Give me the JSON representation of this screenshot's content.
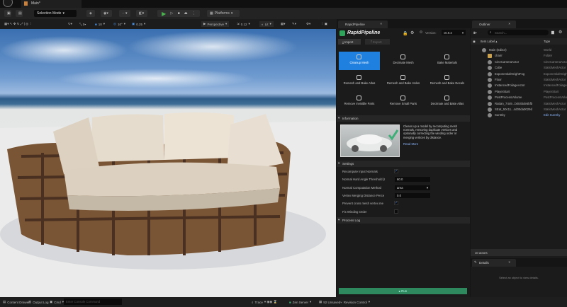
{
  "title_bar": {
    "tab": "Main*"
  },
  "toolbar": {
    "selection_mode": "Selection Mode",
    "platforms": "Platforms"
  },
  "viewport_toolbar": {
    "snap_translate": "10",
    "snap_rotate": "10°",
    "snap_scale": "0.25",
    "view_mode": "Perspective",
    "camera_speed": "0.12",
    "lighting": "Lit",
    "grid": "0"
  },
  "rapid_pipeline": {
    "tab": "RapidPipeline",
    "brand": "RapidPipeline",
    "version_label": "Version:",
    "version": "v0.9.3",
    "import": "Import",
    "export": "Export",
    "tools": [
      {
        "label": "Cleanup Mesh",
        "active": true
      },
      {
        "label": "Decimate Mesh"
      },
      {
        "label": "Bake Materials"
      },
      {
        "label": "Remesh and Bake Atlas"
      },
      {
        "label": "Remesh and Bake Holes"
      },
      {
        "label": "Remesh and Bake Decals"
      },
      {
        "label": "Remove Invisible Parts"
      },
      {
        "label": "Remove Small Parts"
      },
      {
        "label": "Decimate and Bake Atlas"
      }
    ],
    "information": {
      "header": "Information",
      "description": "Cleans up a model by recomputing mesh normals, removing duplicate vertices and optionally correcting the winding order or merging vertices by distance.",
      "read_more": "Read More"
    },
    "settings": {
      "header": "Settings",
      "rows": [
        {
          "label": "Recompute Input Normals",
          "type": "checkbox",
          "checked": true
        },
        {
          "label": "Normal Hard Angle Threshold (I",
          "type": "number",
          "value": "60.0"
        },
        {
          "label": "Normal Computation Method",
          "type": "select",
          "value": "area"
        },
        {
          "label": "Vertex Merging Distance Perce",
          "type": "number",
          "value": "0.0"
        },
        {
          "label": "Prevent cross mesh vertex me",
          "type": "checkbox",
          "checked": true
        },
        {
          "label": "Fix Winding Order",
          "type": "checkbox",
          "checked": false
        }
      ]
    },
    "process_log": "Process Log",
    "run": "Run",
    "accent": "#1f80e0",
    "run_color": "#2e8a5e"
  },
  "outliner": {
    "tab": "Outliner",
    "search_placeholder": "Search...",
    "col_label": "Item Label ▴",
    "col_type": "Type",
    "items": [
      {
        "label": "Main (Editor)",
        "type": "World"
      },
      {
        "label": "chairr",
        "type": "Folder"
      },
      {
        "label": "CineCameraActor",
        "type": "CineCameraActor"
      },
      {
        "label": "Cube",
        "type": "StaticMeshActor"
      },
      {
        "label": "ExponentialHeightFog",
        "type": "ExponentialHeightFog"
      },
      {
        "label": "Floor",
        "type": "StaticMeshActor"
      },
      {
        "label": "InstancedFoliageActor",
        "type": "InstancedFoliageActor"
      },
      {
        "label": "PlayerStart",
        "type": "PlayerStart"
      },
      {
        "label": "PostProcessVolume",
        "type": "PostProcessVolume"
      },
      {
        "label": "Rattan_7449...b004bde5bfb",
        "type": "StaticMeshActor"
      },
      {
        "label": "SEat_50c11...4d00da0029d",
        "type": "StaticMeshActor"
      },
      {
        "label": "SunSky",
        "type": "Edit SunSky"
      }
    ],
    "count": "10 actors"
  },
  "details": {
    "tab": "Details",
    "empty": "Select an object to view details."
  },
  "status_bar": {
    "content_drawer": "Content Drawer",
    "output_log": "Output Log",
    "cmd": "Cmd",
    "console_placeholder": "Enter Console Command",
    "trace": "Trace",
    "zen": "Zen Server",
    "unsaved": "92 Unsaved",
    "revision": "Revision Control"
  }
}
